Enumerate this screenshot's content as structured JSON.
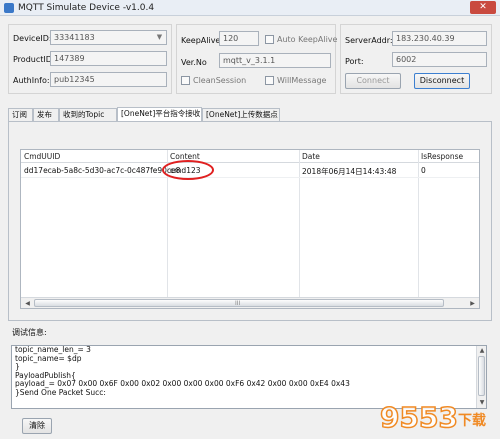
{
  "window": {
    "title": "MQTT Simulate Device  -v1.0.4",
    "close_label": "✕"
  },
  "device": {
    "device_id_label": "DeviceID:",
    "device_id_value": "33341183",
    "product_id_label": "ProductID:",
    "product_id_value": "147389",
    "auth_info_label": "AuthInfo:",
    "auth_info_value": "pub12345"
  },
  "settings": {
    "keepalive_label": "KeepAlive:",
    "keepalive_value": "120",
    "auto_keepalive_label": "Auto KeepAlive",
    "version_label": "Ver.No",
    "version_value": "mqtt_v_3.1.1",
    "clean_session_label": "CleanSession",
    "will_message_label": "WillMessage"
  },
  "server": {
    "addr_label": "ServerAddr:",
    "addr_value": "183.230.40.39",
    "port_label": "Port:",
    "port_value": "6002",
    "connect_label": "Connect",
    "disconnect_label": "Disconnect"
  },
  "tabs": [
    {
      "label": "订阅"
    },
    {
      "label": "发布"
    },
    {
      "label": "收到的Topic"
    },
    {
      "label": "[OneNet]平台指令接收"
    },
    {
      "label": "[OneNet]上传数据点"
    }
  ],
  "grid": {
    "columns": [
      "CmdUUID",
      "Content",
      "Date",
      "IsResponse"
    ],
    "rows": [
      {
        "uuid": "dd17ecab-5a8c-5d30-ac7c-0c487fe90ce8",
        "content": "cmd123",
        "date": "2018年06月14日14:43:48",
        "is_response": "0"
      }
    ],
    "scroll_grip": "III"
  },
  "debug": {
    "label": "调试信息:",
    "lines": [
      "topic_name_len_= 3",
      "topic_name= $dp",
      "}",
      "PayloadPublish{",
      "payload_= 0x07 0x00 0x6F 0x00 0x02 0x00 0x00 0x00 0xF6 0x42 0x00 0x00 0xE4 0x43",
      "}Send One Packet Succ:"
    ]
  },
  "clear_label": "清除",
  "watermark_text": "9553下载"
}
